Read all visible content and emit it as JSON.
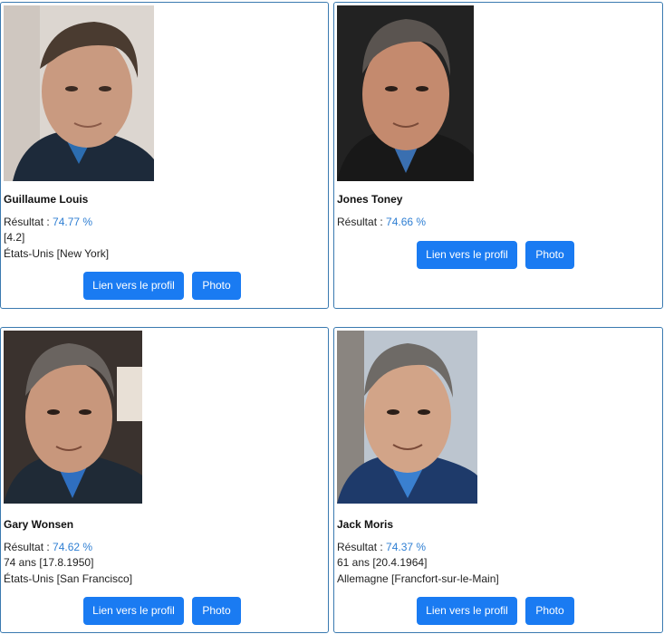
{
  "results": [
    {
      "name": "Guillaume Louis",
      "score_label": "Résultat : ",
      "score": "74.77 %",
      "lines": [
        "[4.2]",
        "États-Unis [New York]"
      ],
      "profile_button": "Lien vers le profil",
      "photo_button": "Photo",
      "photo_bg": "#d9d4cf"
    },
    {
      "name": "Jones Toney",
      "score_label": "Résultat : ",
      "score": "74.66 %",
      "lines": [],
      "profile_button": "Lien vers le profil",
      "photo_button": "Photo",
      "photo_bg": "#2a2a2a"
    },
    {
      "name": "Gary Wonsen",
      "score_label": "Résultat : ",
      "score": "74.62 %",
      "lines": [
        "74 ans [17.8.1950]",
        "États-Unis [San Francisco]"
      ],
      "profile_button": "Lien vers le profil",
      "photo_button": "Photo",
      "photo_bg": "#3a3330"
    },
    {
      "name": "Jack Moris",
      "score_label": "Résultat : ",
      "score": "74.37 %",
      "lines": [
        "61 ans [20.4.1964]",
        "Allemagne [Francfort-sur-le-Main]"
      ],
      "profile_button": "Lien vers le profil",
      "photo_button": "Photo",
      "photo_bg": "#b9c3cf"
    }
  ],
  "colors": {
    "accent": "#1a7bf2",
    "score": "#2f7fd3",
    "border": "#3a7ab0"
  }
}
